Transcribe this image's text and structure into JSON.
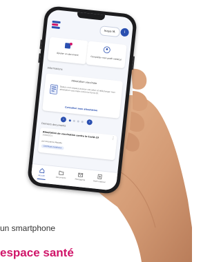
{
  "app": {
    "user_name": "Inaya M.",
    "avatar_initial": "I"
  },
  "action_cards": [
    {
      "label": "Ajouter un document",
      "icon": "add-document-icon"
    },
    {
      "label": "Compléter mon profil médical",
      "icon": "medical-profile-icon"
    }
  ],
  "informations": {
    "section_title": "Informations",
    "card_title": "Attestation vaccinale",
    "card_body": "Depuis mon espace je peux consulter et télécharger mon attestation vaccinale contre la Covid-19.",
    "card_link": "Consulter mon attestation"
  },
  "pager": {
    "prev_icon": "chevron-left-icon",
    "next_icon": "chevron-right-icon",
    "dots": 4,
    "active_dot": 1
  },
  "documents": {
    "section_title": "Derniers documents",
    "item_title": "Attestation de vaccination contre la Covid-19",
    "item_date": "20/08/2021",
    "item_author": "par Assurance Maladie",
    "item_tag": "Certificats médicaux"
  },
  "bottom_nav": [
    {
      "label": "Accueil",
      "icon": "home-icon",
      "active": true
    },
    {
      "label": "Documents",
      "icon": "documents-icon",
      "active": false
    },
    {
      "label": "Messagerie",
      "icon": "messages-icon",
      "active": false
    },
    {
      "label": "Profil médical",
      "icon": "medical-profile-icon",
      "active": false
    }
  ],
  "caption": "un smartphone",
  "headline": "espace santé",
  "colors": {
    "accent": "#2a4fb0",
    "headline": "#d01569",
    "skin": "#d9a27c"
  }
}
